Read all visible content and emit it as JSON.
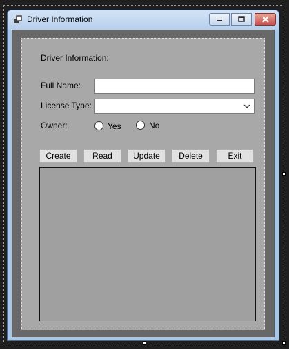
{
  "window": {
    "title": "Driver Information",
    "icons": {
      "app": "form-icon",
      "minimize": "minimize-icon",
      "maximize": "maximize-icon",
      "close": "close-icon"
    }
  },
  "form": {
    "heading": "Driver Information:",
    "full_name_label": "Full Name:",
    "full_name_value": "",
    "license_type_label": "License Type:",
    "license_type_value": "",
    "owner_label": "Owner:",
    "owner_yes": "Yes",
    "owner_no": "No"
  },
  "buttons": {
    "create": "Create",
    "read": "Read",
    "update": "Update",
    "delete": "Delete",
    "exit": "Exit"
  },
  "colors": {
    "client_bg": "#686868",
    "panel_bg": "#a8a8a8",
    "grid_bg": "#a0a0a0",
    "button_bg": "#e1e1e1",
    "close_button": "#c75050"
  }
}
